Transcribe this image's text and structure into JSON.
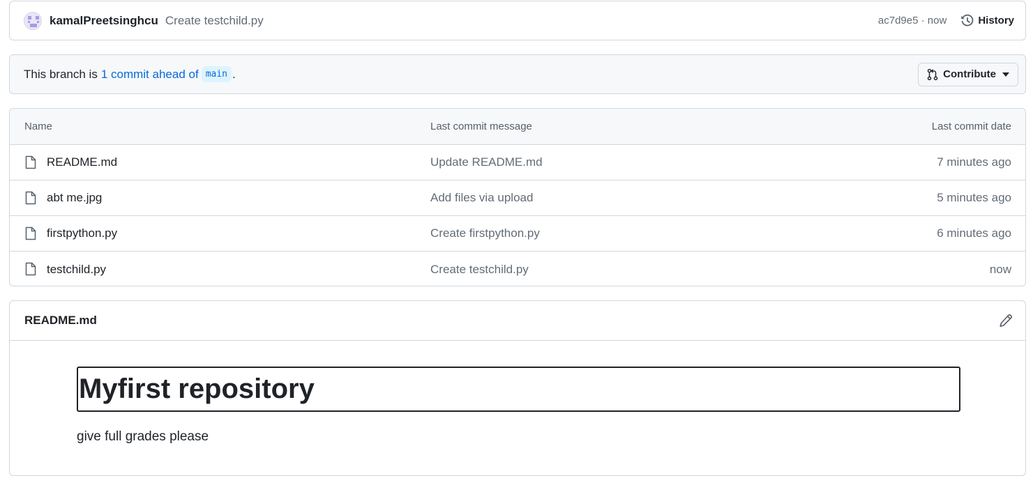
{
  "commit": {
    "author": "kamalPreetsinghcu",
    "message": "Create testchild.py",
    "sha_time": "ac7d9e5 · now",
    "history_label": "History"
  },
  "branch": {
    "prefix": "This branch is",
    "ahead_link": "1 commit ahead of",
    "base": "main",
    "suffix": ".",
    "contribute_label": "Contribute"
  },
  "files": {
    "headers": {
      "name": "Name",
      "message": "Last commit message",
      "date": "Last commit date"
    },
    "rows": [
      {
        "name": "README.md",
        "message": "Update README.md",
        "date": "7 minutes ago"
      },
      {
        "name": "abt me.jpg",
        "message": "Add files via upload",
        "date": "5 minutes ago"
      },
      {
        "name": "firstpython.py",
        "message": "Create firstpython.py",
        "date": "6 minutes ago"
      },
      {
        "name": "testchild.py",
        "message": "Create testchild.py",
        "date": "now"
      }
    ]
  },
  "readme": {
    "title": "README.md",
    "heading": "Myfirst repository",
    "paragraph": "give full grades please"
  },
  "icons": {
    "avatar": "identicon-avatar",
    "history": "history-clock-icon",
    "contribute": "git-pull-request-icon",
    "file": "file-icon",
    "edit": "pencil-icon"
  },
  "colors": {
    "link": "#0969da",
    "muted": "#636c76",
    "border": "#d0d7de",
    "header_bg": "#f6f8fa"
  }
}
